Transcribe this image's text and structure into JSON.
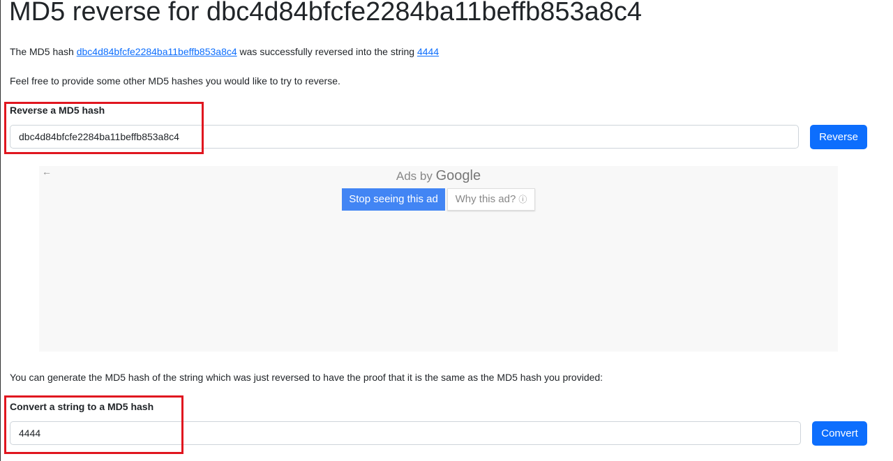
{
  "page": {
    "title": "MD5 reverse for dbc4d84bfcfe2284ba11beffb853a8c4"
  },
  "result": {
    "prefix": "The MD5 hash ",
    "hash_link": "dbc4d84bfcfe2284ba11beffb853a8c4",
    "middle": " was successfully reversed into the string ",
    "string_link": "4444"
  },
  "intro": "Feel free to provide some other MD5 hashes you would like to try to reverse.",
  "reverse_form": {
    "label": "Reverse a MD5 hash",
    "value": "dbc4d84bfcfe2284ba11beffb853a8c4",
    "button": "Reverse"
  },
  "ad": {
    "back_icon": "←",
    "ads_by": "Ads by",
    "google": "Google",
    "stop_button": "Stop seeing this ad",
    "why_button": "Why this ad?",
    "info_icon": "ⓘ"
  },
  "proof_text": "You can generate the MD5 hash of the string which was just reversed to have the proof that it is the same as the MD5 hash you provided:",
  "convert_form": {
    "label": "Convert a string to a MD5 hash",
    "value": "4444",
    "button": "Convert"
  },
  "colors": {
    "link": "#0d6efd",
    "button": "#0d6efd",
    "highlight": "#e0161f",
    "ad_button": "#4285f4"
  }
}
